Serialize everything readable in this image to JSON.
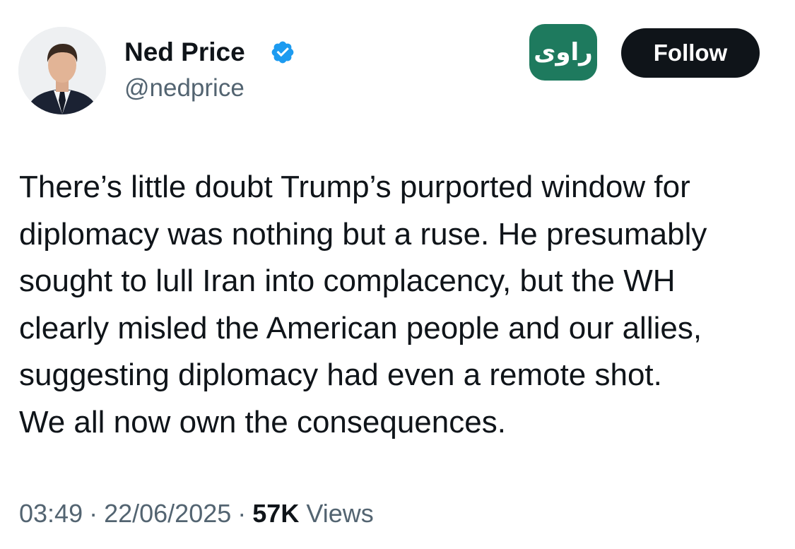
{
  "author": {
    "name": "Ned Price",
    "handle": "@nedprice",
    "verified_icon": "verified-badge-icon",
    "badge_color": "#1d9bf0"
  },
  "brand_logo": {
    "text": "راوی",
    "background": "#1e7a5e"
  },
  "follow_label": "Follow",
  "tweet_lines": [
    "There’s little doubt Trump’s purported window for",
    "diplomacy was nothing but a ruse. He presumably",
    "sought to lull Iran into complacency, but the WH",
    "clearly misled the American people and our allies,",
    "suggesting diplomacy had even a remote shot.",
    "We all now own the consequences."
  ],
  "meta": {
    "time": "03:49",
    "separator": "·",
    "date": "22/06/2025",
    "views_count": "57K",
    "views_label": "Views"
  },
  "colors": {
    "text_primary": "#0f1419",
    "text_secondary": "#536471",
    "button_bg": "#0f1419"
  }
}
